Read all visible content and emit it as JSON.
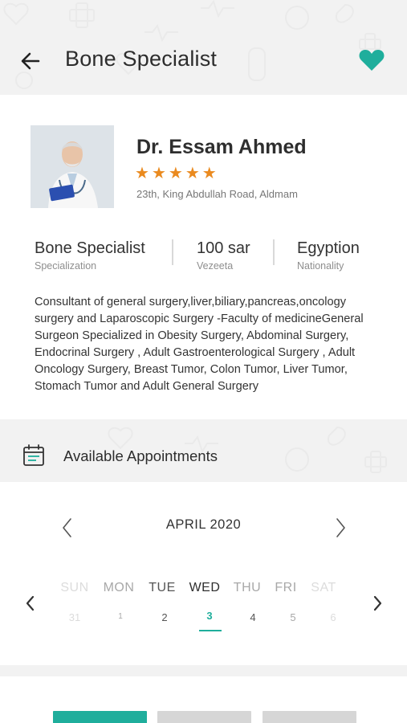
{
  "header": {
    "title": "Bone Specialist",
    "accent_color": "#1fae9c",
    "back_icon": "arrow-left-icon",
    "favorite_icon": "heart-icon"
  },
  "doctor": {
    "name": "Dr. Essam Ahmed",
    "rating": 5,
    "rating_max": 5,
    "star_color": "#ea8a1f",
    "address": "23th, King Abdullah Road, Aldmam",
    "stats": [
      {
        "value": "Bone Specialist",
        "label": "Specialization"
      },
      {
        "value": "100 sar",
        "label": "Vezeeta"
      },
      {
        "value": "Egyption",
        "label": "Nationality"
      }
    ],
    "bio_lines": [
      "Consultant of general surgery,liver,biliary,pancreas,oncology",
      "surgery and Laparoscopic Surgery -Faculty of medicineGeneral",
      "Surgeon Specialized in Obesity Surgery, Abdominal Surgery,",
      "Endocrinal Surgery , Adult Gastroenterological Surgery , Adult",
      "Oncology Surgery, Breast Tumor, Colon Tumor, Liver Tumor,",
      "Stomach Tumor and Adult General Surgery"
    ]
  },
  "appointments": {
    "title": "Available Appointments",
    "icon": "calendar-icon"
  },
  "calendar": {
    "month_label": "APRIL  2020",
    "days": [
      {
        "dow": "SUN",
        "num": "31"
      },
      {
        "dow": "MON",
        "num": "1"
      },
      {
        "dow": "TUE",
        "num": "2"
      },
      {
        "dow": "WED",
        "num": "3"
      },
      {
        "dow": "THU",
        "num": "4"
      },
      {
        "dow": "FRI",
        "num": "5"
      },
      {
        "dow": "SAT",
        "num": "6"
      }
    ],
    "selected_index": 3
  },
  "time_slot_colors": [
    "#1fae9c",
    "#d6d6d6",
    "#d6d6d6"
  ]
}
